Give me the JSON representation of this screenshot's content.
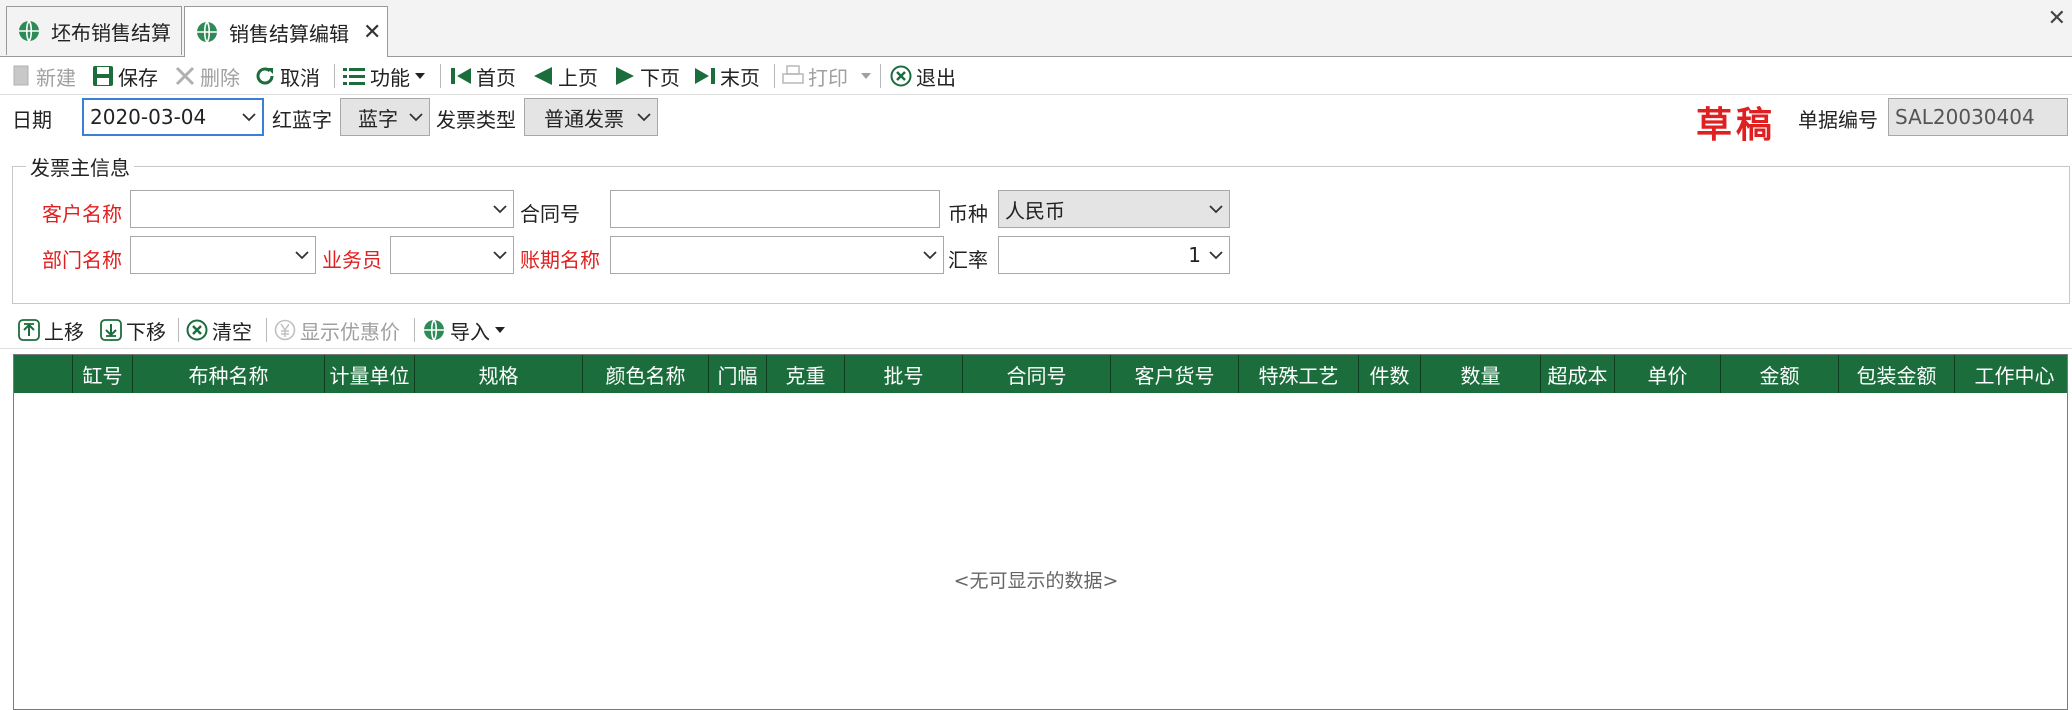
{
  "tabs": [
    {
      "label": "坯布销售结算"
    },
    {
      "label": "销售结算编辑"
    }
  ],
  "toolbar": {
    "new": "新建",
    "save": "保存",
    "delete": "删除",
    "cancel": "取消",
    "function": "功能",
    "first": "首页",
    "prev": "上页",
    "next": "下页",
    "last": "末页",
    "print": "打印",
    "exit": "退出"
  },
  "header": {
    "date_label": "日期",
    "date_value": "2020-03-04",
    "redblue_label": "红蓝字",
    "redblue_value": "蓝字",
    "invoice_type_label": "发票类型",
    "invoice_type_value": "普通发票",
    "status": "草稿",
    "doc_no_label": "单据编号",
    "doc_no_value": "SAL20030404"
  },
  "invoice_group": {
    "title": "发票主信息",
    "customer_label": "客户名称",
    "customer_value": "",
    "contract_label": "合同号",
    "contract_value": "",
    "currency_label": "币种",
    "currency_value": "人民币",
    "dept_label": "部门名称",
    "dept_value": "",
    "salesman_label": "业务员",
    "salesman_value": "",
    "account_period_label": "账期名称",
    "account_period_value": "",
    "rate_label": "汇率",
    "rate_value": "1"
  },
  "detail_toolbar": {
    "move_up": "上移",
    "move_down": "下移",
    "clear": "清空",
    "show_discount": "显示优惠价",
    "import": "导入"
  },
  "grid": {
    "columns": [
      "缸号",
      "布种名称",
      "计量单位",
      "规格",
      "颜色名称",
      "门幅",
      "克重",
      "批号",
      "合同号",
      "客户货号",
      "特殊工艺",
      "件数",
      "数量",
      "超成本",
      "单价",
      "金额",
      "包装金额",
      "工作中心"
    ],
    "rows": [],
    "empty_text": "<无可显示的数据>"
  },
  "colors": {
    "grid_header": "#1b6d3c",
    "required_label": "#e02020",
    "icon_green": "#2e8b57"
  }
}
